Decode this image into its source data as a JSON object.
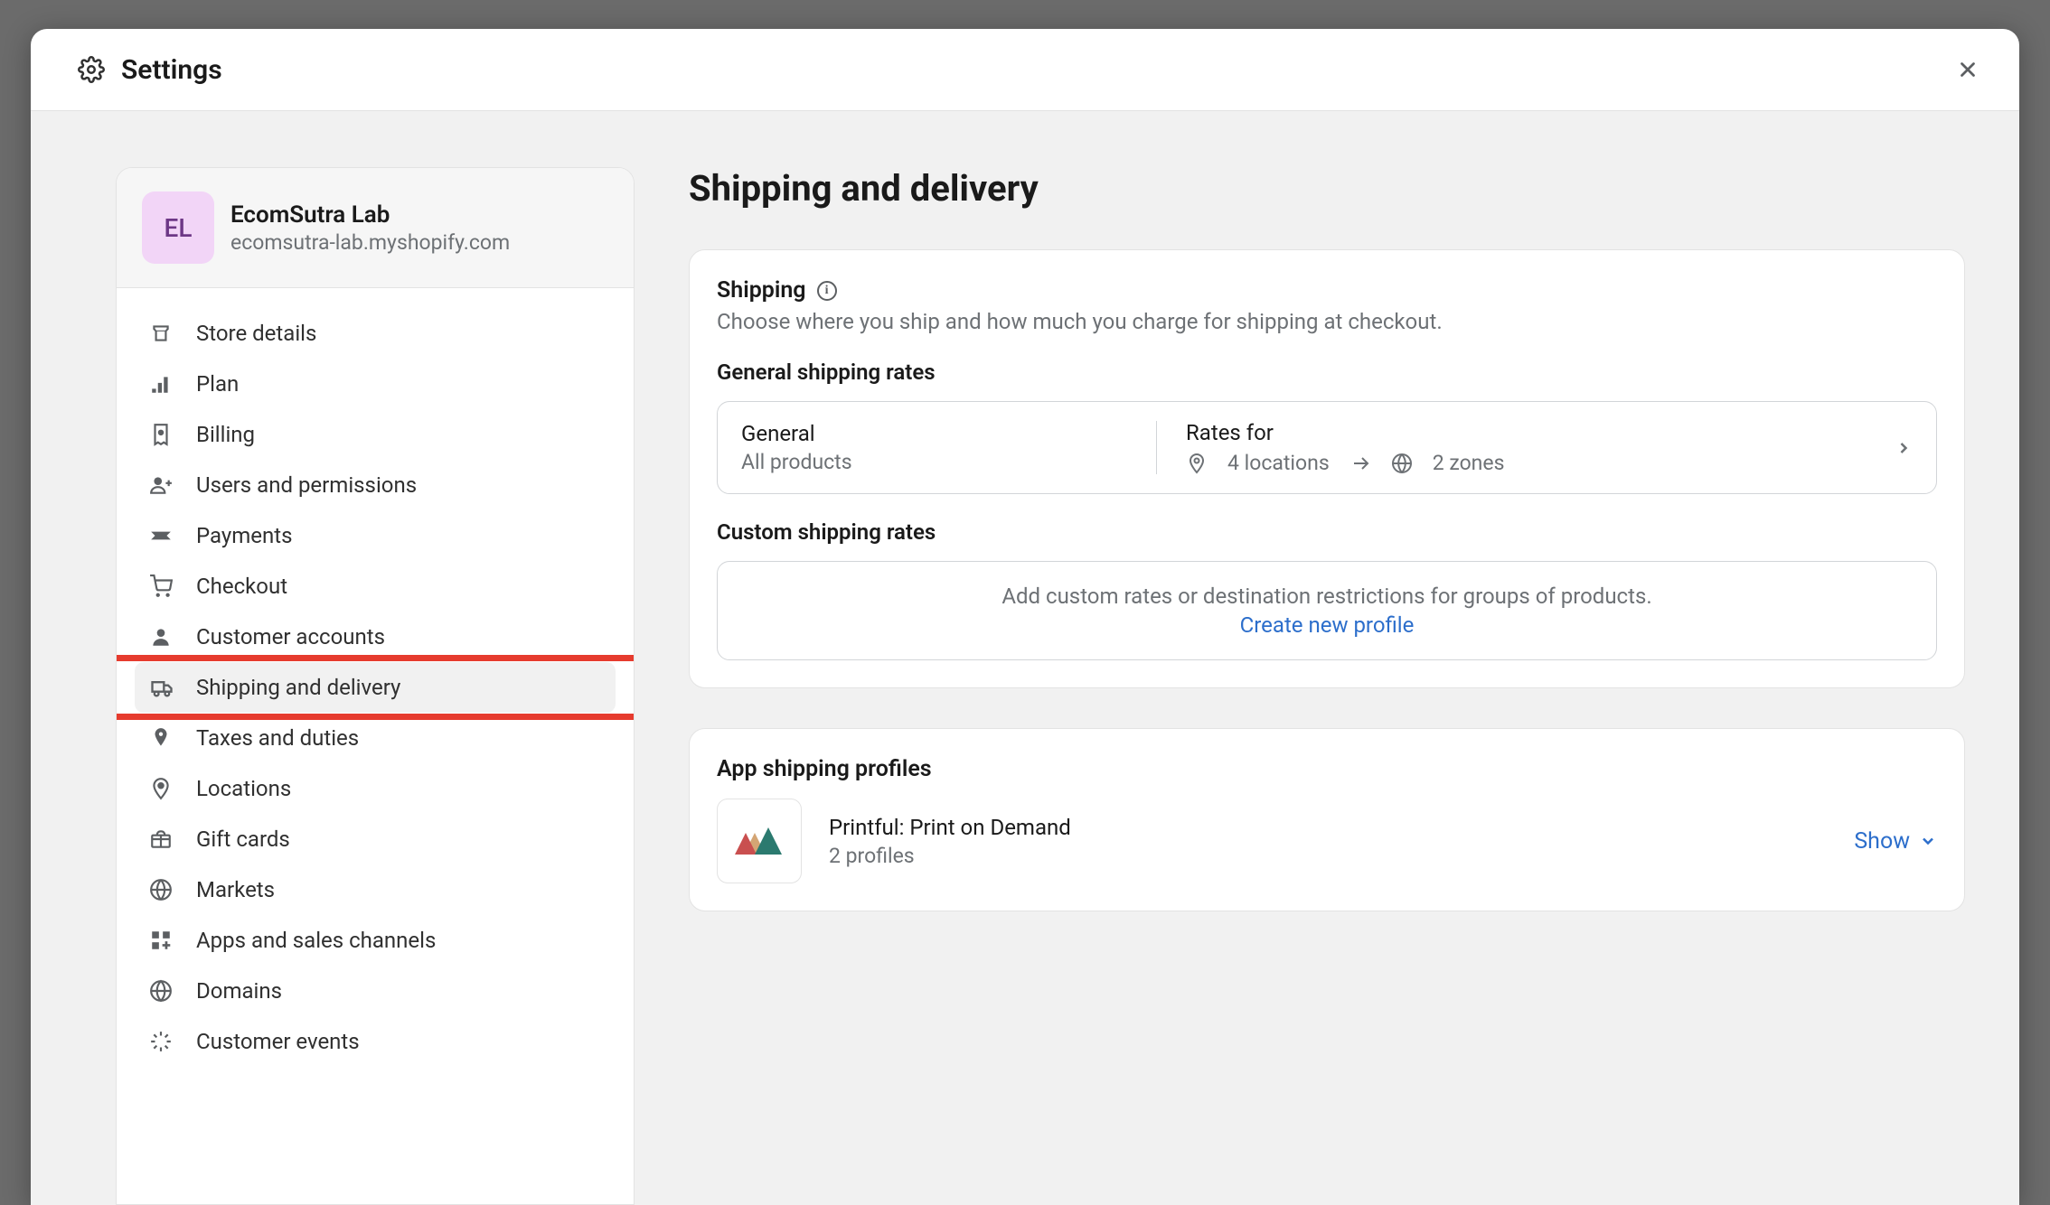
{
  "header": {
    "title": "Settings"
  },
  "store": {
    "initials": "EL",
    "name": "EcomSutra Lab",
    "domain": "ecomsutra-lab.myshopify.com"
  },
  "sidebar": {
    "items": [
      {
        "label": "Store details"
      },
      {
        "label": "Plan"
      },
      {
        "label": "Billing"
      },
      {
        "label": "Users and permissions"
      },
      {
        "label": "Payments"
      },
      {
        "label": "Checkout"
      },
      {
        "label": "Customer accounts"
      },
      {
        "label": "Shipping and delivery"
      },
      {
        "label": "Taxes and duties"
      },
      {
        "label": "Locations"
      },
      {
        "label": "Gift cards"
      },
      {
        "label": "Markets"
      },
      {
        "label": "Apps and sales channels"
      },
      {
        "label": "Domains"
      },
      {
        "label": "Customer events"
      }
    ]
  },
  "page": {
    "title": "Shipping and delivery",
    "shipping": {
      "heading": "Shipping",
      "subtext": "Choose where you ship and how much you charge for shipping at checkout.",
      "general_heading": "General shipping rates",
      "profile": {
        "name": "General",
        "coverage": "All products",
        "rates_for_label": "Rates for",
        "locations": "4 locations",
        "zones": "2 zones"
      },
      "custom_heading": "Custom shipping rates",
      "custom_text": "Add custom rates or destination restrictions for groups of products.",
      "custom_link": "Create new profile"
    },
    "app_profiles": {
      "heading": "App shipping profiles",
      "app_name": "Printful: Print on Demand",
      "app_sub": "2 profiles",
      "show_label": "Show"
    }
  }
}
